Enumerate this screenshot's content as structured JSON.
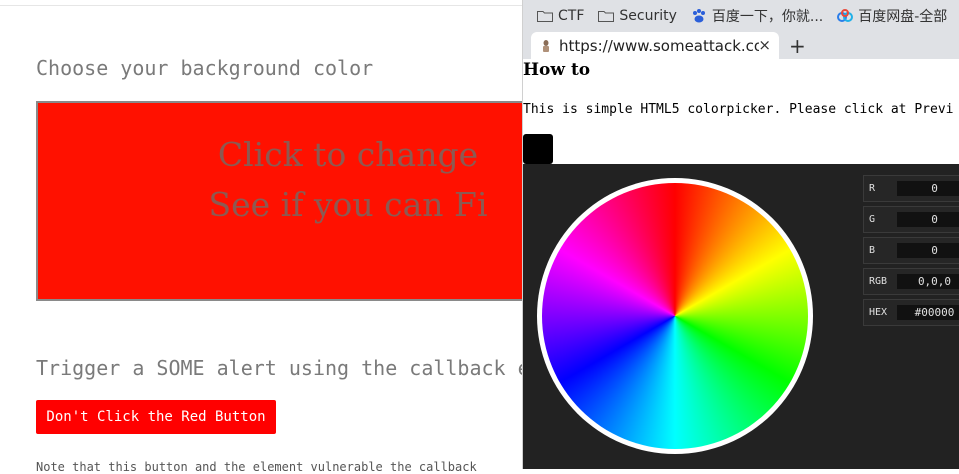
{
  "main": {
    "heading": "Choose your background color",
    "box_line1": "Click to change",
    "box_line2": "See if you can Fi",
    "trigger_text": "Trigger a SOME alert using the callback e",
    "red_button_label": "Don't Click the Red Button",
    "note_text": "Note that this button and the element vulnerable the callback",
    "box_color": "#ff1100",
    "button_color": "#ff0000"
  },
  "popup": {
    "bookmarks": [
      {
        "label": "CTF",
        "icon": "folder-icon"
      },
      {
        "label": "Security",
        "icon": "folder-icon"
      },
      {
        "label": "百度一下，你就...",
        "icon": "baidu-paw-icon"
      },
      {
        "label": "百度网盘-全部",
        "icon": "baidu-cloud-icon"
      }
    ],
    "tab_title": "https://www.someattack.com",
    "tab_close": "×",
    "new_tab": "+",
    "howto_title": "How to",
    "description": "This is simple HTML5 colorpicker. Please click at Previ",
    "swatch_color": "#000000",
    "fields": [
      {
        "label": "R",
        "value": "0"
      },
      {
        "label": "G",
        "value": "0"
      },
      {
        "label": "B",
        "value": "0"
      },
      {
        "label": "RGB",
        "value": "0,0,0"
      },
      {
        "label": "HEX",
        "value": "#00000"
      }
    ]
  }
}
